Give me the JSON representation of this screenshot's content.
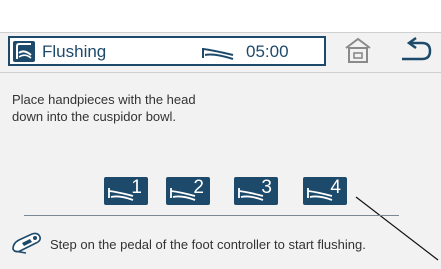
{
  "header": {
    "title": "Flushing",
    "timer": "05:00"
  },
  "instruction": {
    "line1": "Place handpieces with the head",
    "line2": "down into the cuspidor bowl."
  },
  "handpieces": [
    {
      "number": "1"
    },
    {
      "number": "2"
    },
    {
      "number": "3"
    },
    {
      "number": "4"
    }
  ],
  "footer": {
    "text": "Step on the pedal of the foot controller to start flushing."
  },
  "icons": {
    "app": "flushing-icon",
    "handpiece": "handpiece-icon",
    "home": "home-icon",
    "back": "back-arrow-icon",
    "pedal": "foot-pedal-icon"
  },
  "colors": {
    "accent": "#1d4a6b",
    "background": "#f2f2f2",
    "text": "#333333"
  }
}
